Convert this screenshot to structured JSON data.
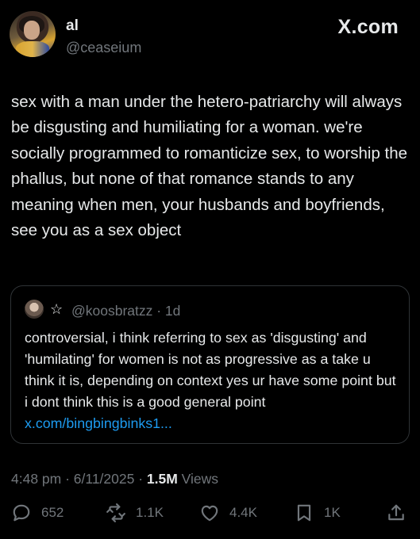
{
  "post": {
    "author_name": "al",
    "author_handle": "@ceaseium",
    "brand": "X.com",
    "text": "sex with a man under the hetero-patriarchy will always be disgusting and humiliating for a woman. we're socially programmed to romanticize sex, to worship the phallus, but none of that romance stands to any meaning when men, your husbands and boyfriends, see you as a sex object"
  },
  "quote": {
    "star": "☆",
    "handle_time": "@koosbratzz · 1d",
    "text": "controversial, i think referring to sex as 'disgusting' and 'humilating' for women is not as progressive as a take u think it is, depending on context yes ur have some point but i dont think this is a good general point ",
    "link": "x.com/bingbingbinks1..."
  },
  "meta": {
    "timestamp": "4:48 pm · 6/11/2025 · ",
    "views_count": "1.5M",
    "views_label": " Views"
  },
  "actions": {
    "replies": "652",
    "reposts": "1.1K",
    "likes": "4.4K",
    "bookmarks": "1K"
  },
  "colors": {
    "background": "#000000",
    "text": "#e7e9ea",
    "muted": "#71767b",
    "link": "#1d9bf0",
    "border": "#2f3336"
  },
  "icons": [
    "reply-icon",
    "repost-icon",
    "like-icon",
    "bookmark-icon",
    "share-icon"
  ]
}
